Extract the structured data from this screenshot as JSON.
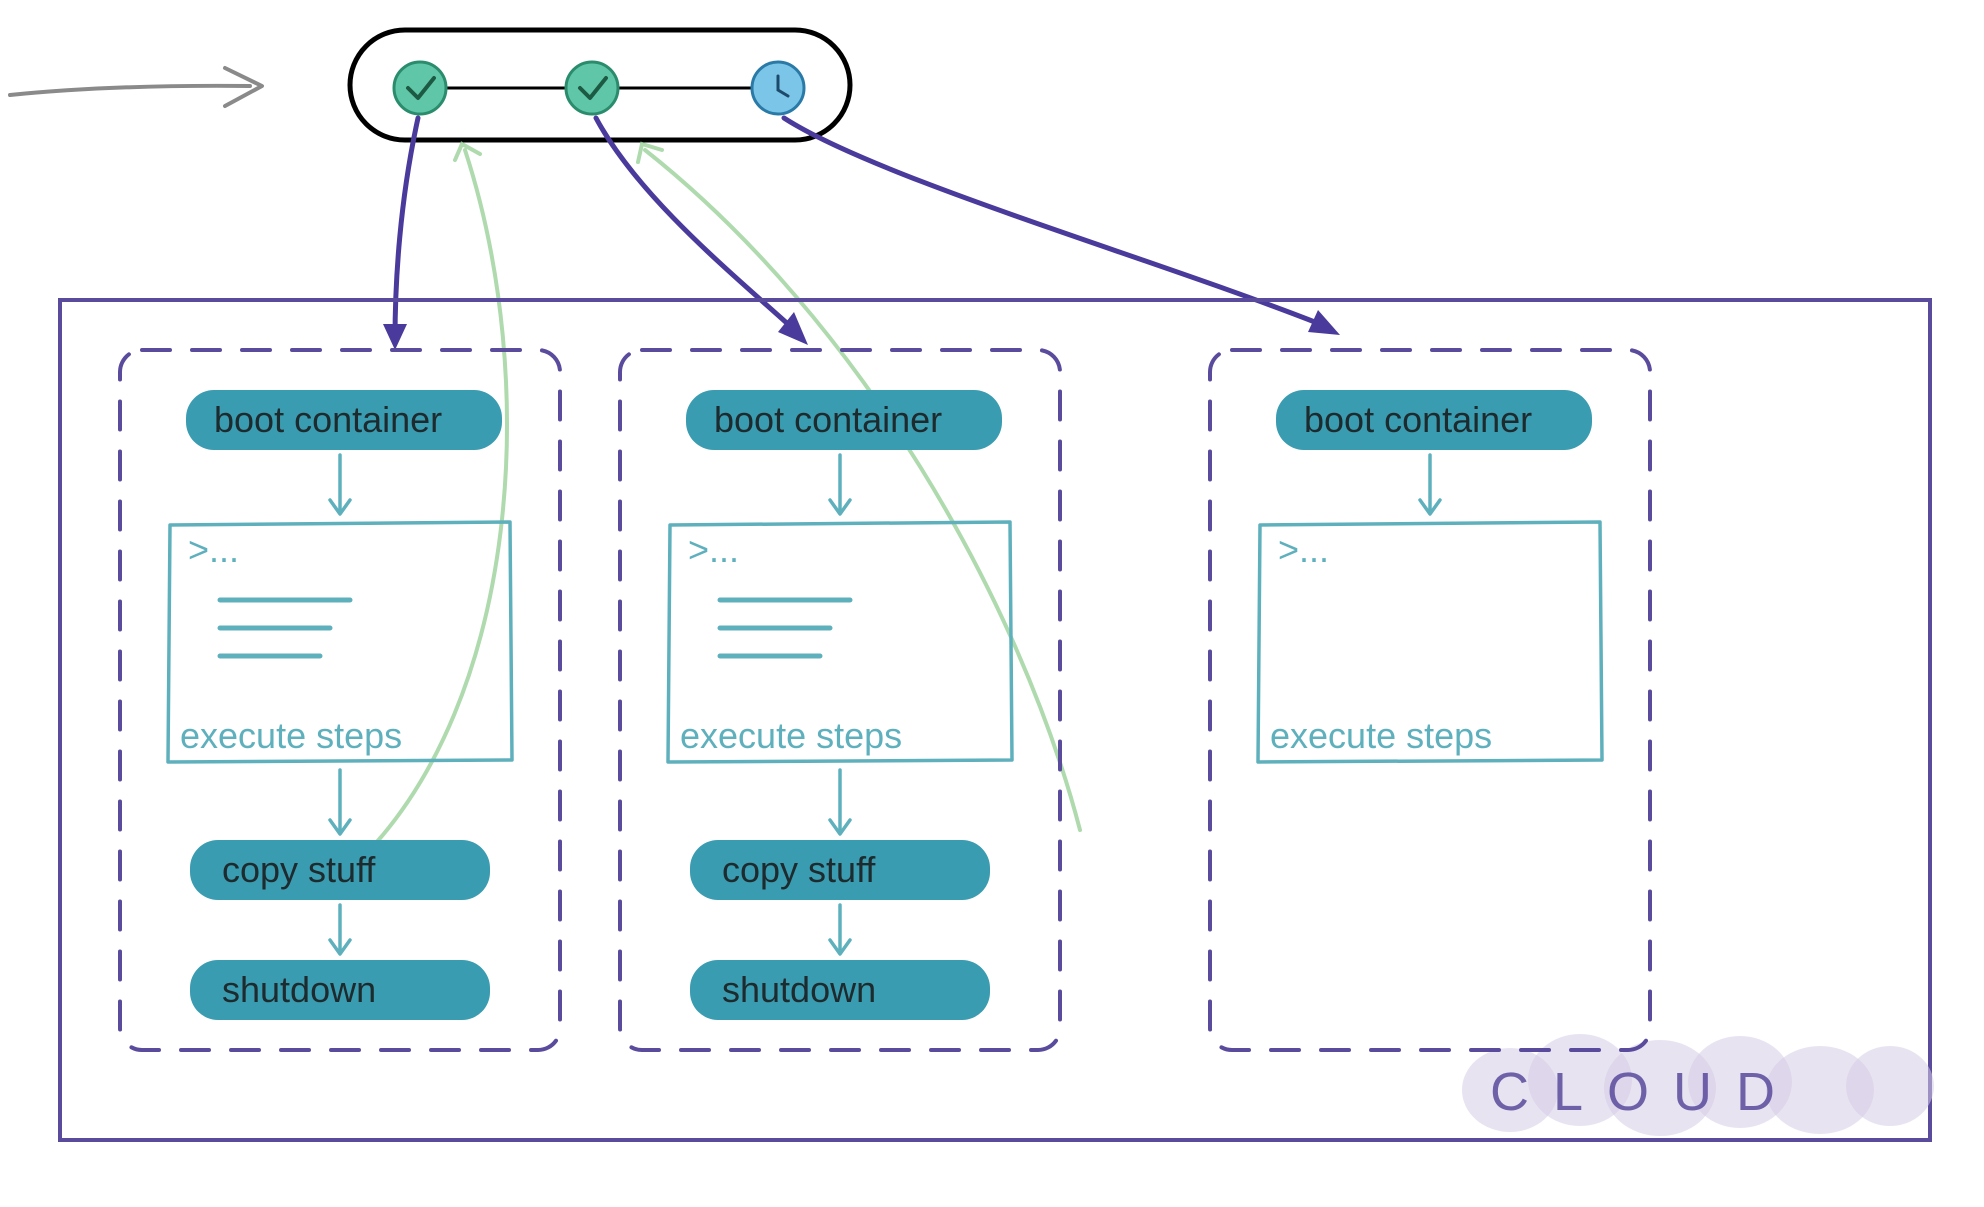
{
  "diagram": {
    "pipeline": {
      "nodes": [
        {
          "status": "done",
          "icon": "check"
        },
        {
          "status": "done",
          "icon": "check"
        },
        {
          "status": "running",
          "icon": "clock"
        }
      ]
    },
    "cloud_label": "CLOUD",
    "jobs": [
      {
        "boot_label": "boot container",
        "execute_label": "execute  steps",
        "terminal_prompt": ">...",
        "has_output_lines": true,
        "copy_label": "copy stuff",
        "shutdown_label": "shutdown",
        "finished": true
      },
      {
        "boot_label": "boot container",
        "execute_label": "execute  steps",
        "terminal_prompt": ">...",
        "has_output_lines": true,
        "copy_label": "copy stuff",
        "shutdown_label": "shutdown",
        "finished": true
      },
      {
        "boot_label": "boot container",
        "execute_label": "execute  steps",
        "terminal_prompt": ">...",
        "has_output_lines": false,
        "finished": false
      }
    ]
  }
}
